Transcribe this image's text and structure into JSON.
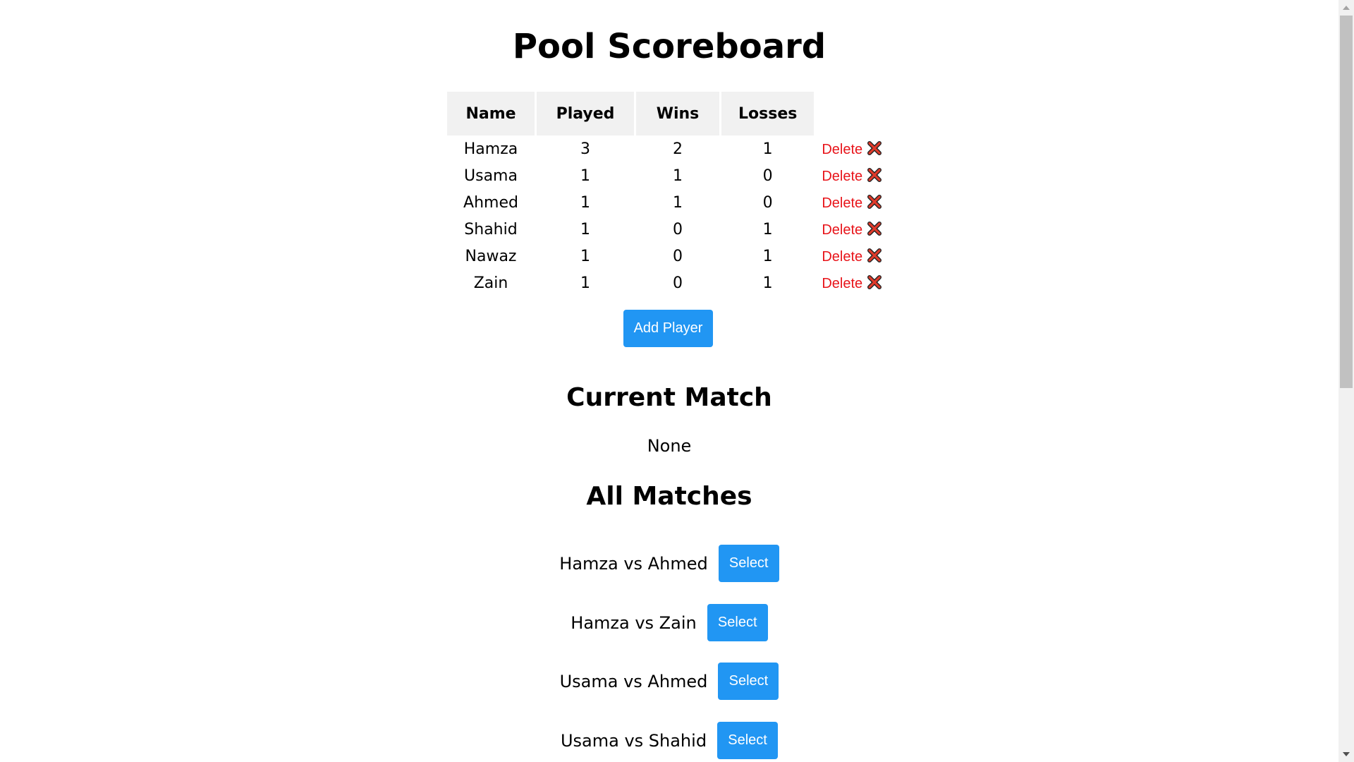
{
  "title": "Pool Scoreboard",
  "table": {
    "headers": [
      "Name",
      "Played",
      "Wins",
      "Losses"
    ],
    "rows": [
      {
        "name": "Hamza",
        "played": "3",
        "wins": "2",
        "losses": "1",
        "action": "Delete"
      },
      {
        "name": "Usama",
        "played": "1",
        "wins": "1",
        "losses": "0",
        "action": "Delete"
      },
      {
        "name": "Ahmed",
        "played": "1",
        "wins": "1",
        "losses": "0",
        "action": "Delete"
      },
      {
        "name": "Shahid",
        "played": "1",
        "wins": "0",
        "losses": "1",
        "action": "Delete"
      },
      {
        "name": "Nawaz",
        "played": "1",
        "wins": "0",
        "losses": "1",
        "action": "Delete"
      },
      {
        "name": "Zain",
        "played": "1",
        "wins": "0",
        "losses": "1",
        "action": "Delete"
      }
    ]
  },
  "add_player_label": "Add Player",
  "current_match": {
    "heading": "Current Match",
    "value": "None"
  },
  "all_matches": {
    "heading": "All Matches",
    "items": [
      {
        "label": "Hamza vs Ahmed",
        "button": "Select"
      },
      {
        "label": "Hamza vs Zain",
        "button": "Select"
      },
      {
        "label": "Usama vs Ahmed",
        "button": "Select"
      },
      {
        "label": "Usama vs Shahid",
        "button": "Select"
      }
    ]
  },
  "icons": {
    "delete": "cross-mark-icon"
  },
  "colors": {
    "accent": "#2196f3",
    "delete": "#e8141a",
    "header_bg": "#f1f1f1"
  }
}
